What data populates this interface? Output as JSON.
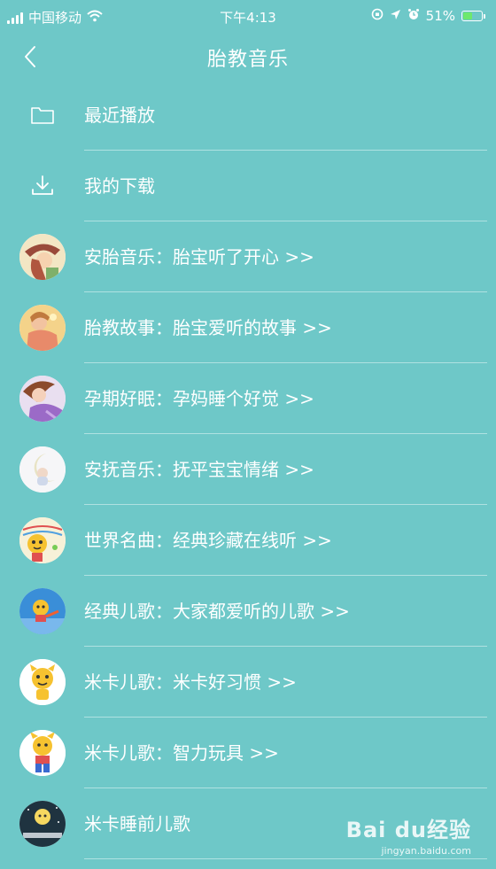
{
  "status_bar": {
    "carrier": "中国移动",
    "time": "下午4:13",
    "battery_percent": "51%",
    "battery_level": 0.51,
    "icons": [
      "signal-icon",
      "wifi-icon",
      "lock-rotation-icon",
      "location-icon",
      "alarm-icon",
      "battery-icon"
    ]
  },
  "nav": {
    "title": "胎教音乐",
    "back_icon": "chevron-left-icon"
  },
  "menu": {
    "recent": {
      "label": "最近播放",
      "icon": "folder-icon"
    },
    "downloads": {
      "label": "我的下载",
      "icon": "download-icon"
    }
  },
  "categories": [
    {
      "label": "安胎音乐：胎宝听了开心 >>",
      "avatar": "girl-with-hat-illustration"
    },
    {
      "label": "胎教故事：胎宝爱听的故事 >>",
      "avatar": "mother-illustration"
    },
    {
      "label": "孕期好眠：孕妈睡个好觉 >>",
      "avatar": "sleeping-woman-illustration"
    },
    {
      "label": "安抚音乐：抚平宝宝情绪 >>",
      "avatar": "moon-baby-illustration"
    },
    {
      "label": "世界名曲：经典珍藏在线听 >>",
      "avatar": "mika-music-illustration"
    },
    {
      "label": "经典儿歌：大家都爱听的儿歌 >>",
      "avatar": "mika-flying-illustration"
    },
    {
      "label": "米卡儿歌：米卡好习惯 >>",
      "avatar": "mika-cartoon-illustration"
    },
    {
      "label": "米卡儿歌：智力玩具 >>",
      "avatar": "mika-toy-illustration"
    },
    {
      "label": "米卡睡前儿歌",
      "avatar": "mika-night-illustration"
    }
  ],
  "watermark": {
    "main": "Bai du经验",
    "sub": "jingyan.baidu.com"
  },
  "colors": {
    "background": "#6ec8c8",
    "text": "#ffffff",
    "battery_fill": "#6ee86e"
  }
}
